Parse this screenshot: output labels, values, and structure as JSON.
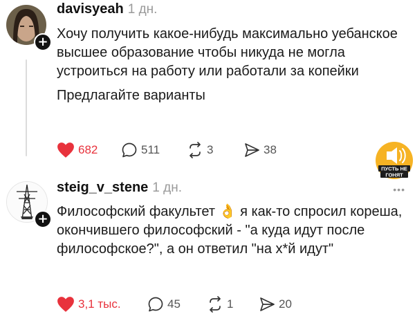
{
  "posts": [
    {
      "username": "davisyeah",
      "time": "1 дн.",
      "paragraphs": [
        "Хочу получить какое-нибудь максимально уебанское высшее образование чтобы никуда не могла устроиться на работу или работали за копейки",
        "Предлагайте варианты"
      ],
      "likes": "682",
      "comments": "511",
      "reposts": "3",
      "shares": "38"
    },
    {
      "username": "steig_v_stene",
      "time": "1 дн.",
      "text_before": "Философский факультет",
      "emoji": "👌",
      "text_after": "я как-то спросил кореша, окончившего философский - \"а куда идут после философское?\", а он ответил \"на х*й идут\"",
      "likes": "3,1 тыс.",
      "comments": "45",
      "reposts": "1",
      "shares": "20"
    }
  ],
  "sticker": {
    "line1": "ПУСТЬ НЕ",
    "line2": "ГОНЯТ"
  },
  "more_menu": "•••",
  "follow_symbol": "+",
  "colors": {
    "like": "#e8323c",
    "muted": "#9a9a9a",
    "sticker": "#f6b324"
  }
}
